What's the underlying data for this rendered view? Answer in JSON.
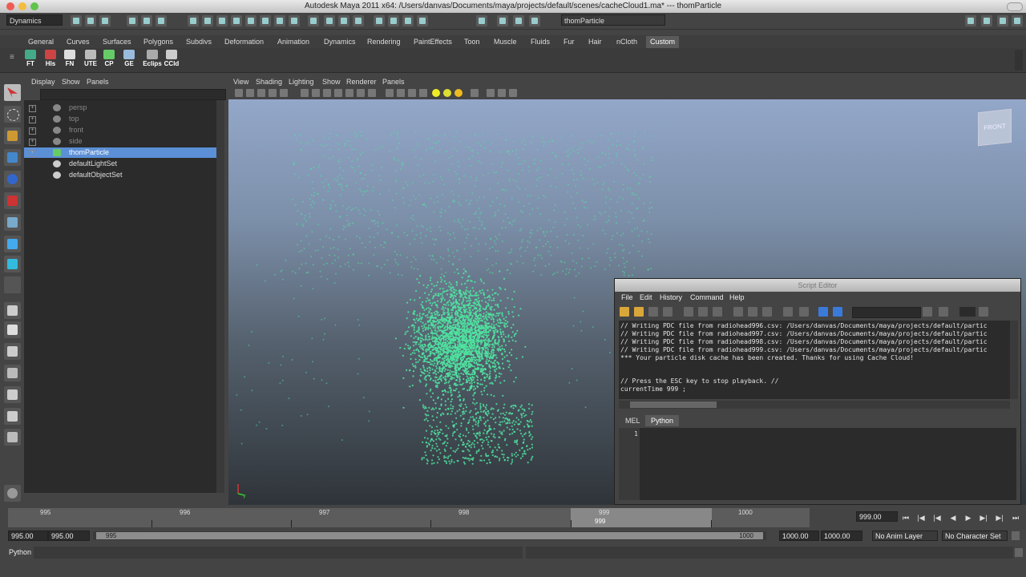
{
  "window": {
    "title": "Autodesk Maya 2011 x64: /Users/danvas/Documents/maya/projects/default/scenes/cacheCloud1.ma*   ---   thomParticle"
  },
  "status_line": {
    "menu_set": "Dynamics",
    "name_field": "thomParticle"
  },
  "shelf": {
    "tabs": [
      "General",
      "Curves",
      "Surfaces",
      "Polygons",
      "Subdivs",
      "Deformation",
      "Animation",
      "Dynamics",
      "Rendering",
      "PaintEffects",
      "Toon",
      "Muscle",
      "Fluids",
      "Fur",
      "Hair",
      "nCloth",
      "Custom"
    ],
    "active_tab": "Custom",
    "buttons": [
      "FT",
      "Hls",
      "FN",
      "UTE",
      "CP",
      "GE",
      "Eclips",
      "CCld"
    ]
  },
  "outliner": {
    "menu": [
      "Display",
      "Show",
      "Panels"
    ],
    "items": [
      {
        "label": "persp",
        "kind": "camera"
      },
      {
        "label": "top",
        "kind": "camera"
      },
      {
        "label": "front",
        "kind": "camera"
      },
      {
        "label": "side",
        "kind": "camera"
      },
      {
        "label": "thomParticle",
        "kind": "particle",
        "selected": true
      },
      {
        "label": "defaultLightSet",
        "kind": "set"
      },
      {
        "label": "defaultObjectSet",
        "kind": "set"
      }
    ]
  },
  "viewport": {
    "menu": [
      "View",
      "Shading",
      "Lighting",
      "Show",
      "Renderer",
      "Panels"
    ],
    "viewcube_label": "FRONT",
    "particle_color": "#4fe3a0"
  },
  "script_editor": {
    "title": "Script Editor",
    "menu": [
      "File",
      "Edit",
      "History",
      "Command",
      "Help"
    ],
    "history": [
      "// Writing PDC file from radiohead996.csv: /Users/danvas/Documents/maya/projects/default/partic",
      "// Writing PDC file from radiohead997.csv: /Users/danvas/Documents/maya/projects/default/partic",
      "// Writing PDC file from radiohead998.csv: /Users/danvas/Documents/maya/projects/default/partic",
      "// Writing PDC file from radiohead999.csv: /Users/danvas/Documents/maya/projects/default/partic",
      "*** Your particle disk cache has been created. Thanks for using Cache Cloud!",
      "",
      "",
      "// Press the ESC key to stop playback. //",
      "currentTime 999 ;"
    ],
    "tabs": [
      "MEL",
      "Python"
    ],
    "active_tab": "Python",
    "line_number": "1"
  },
  "time_slider": {
    "ticks": [
      "995",
      "996",
      "997",
      "998",
      "999",
      "1000"
    ],
    "current_frame": "999",
    "current_time": "999.00"
  },
  "range_slider": {
    "anim_start": "995.00",
    "range_start": "995.00",
    "slider_start": "995",
    "slider_end": "1000",
    "range_end": "1000.00",
    "anim_end": "1000.00",
    "anim_layer": "No Anim Layer",
    "character_set": "No Character Set"
  },
  "command_line": {
    "language": "Python"
  }
}
